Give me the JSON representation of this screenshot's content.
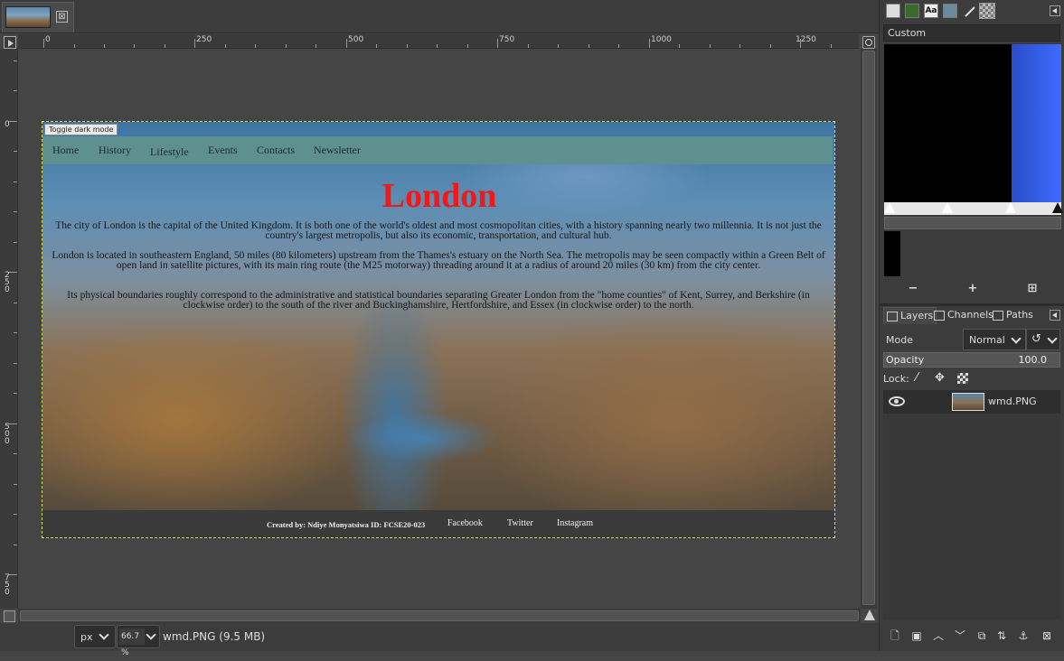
{
  "image_tab": {
    "close_glyph": "⊠"
  },
  "ruler": {
    "h_labels": [
      "0",
      "250",
      "500",
      "750",
      "1000",
      "1250"
    ],
    "v_labels": [
      "0",
      "250",
      "500",
      "750"
    ]
  },
  "webpage": {
    "dark_mode_button": "Toggle dark mode",
    "nav": [
      "Home",
      "History",
      "Lifestyle",
      "Events",
      "Contacts",
      "Newsletter"
    ],
    "title": "London",
    "paragraphs": [
      "The city of London is the capital of the United Kingdom. It is both one of the world's oldest and most cosmopolitan cities, with a history spanning nearly two millennia. It is not just the country's largest metropolis, but also its economic, transportation, and cultural hub.",
      "London is located in southeastern England, 50 miles (80 kilometers) upstream from the Thames's estuary on the North Sea. The metropolis may be seen compactly within a Green Belt of open land in satellite pictures, with its main ring route (the M25 motorway) threading around it at a radius of around 20 miles (30 km) from the city center.",
      "Its physical boundaries roughly correspond to the administrative and statistical boundaries separating Greater London from the \"home counties\" of Kent, Surrey, and Berkshire (in clockwise order) to the south of the river and Buckinghamshire, Hertfordshire, and Essex (in clockwise order) to the north."
    ],
    "footer": {
      "credit": "Created by: Ndiye Monyatsiwa ID: FCSE20-023",
      "links": [
        "Facebook",
        "Twitter",
        "Instagram"
      ]
    },
    "colors": {
      "title": "#ee1a1a",
      "nav_bg": "#5f9090",
      "footer_bg": "#3a3a3a"
    }
  },
  "statusbar": {
    "unit": "px",
    "zoom": "66.7 %",
    "file_info": "wmd.PNG (9.5 MB)"
  },
  "dock": {
    "tab_icons": [
      "brush-icon",
      "pattern-icon",
      "font-icon",
      "document-icon",
      "paintbrush-icon",
      "gradient-icon"
    ],
    "gradient_name": "Custom",
    "gradient_buttons": [
      "−",
      "+",
      "⊞"
    ],
    "layer_tabs": [
      "Layers",
      "Channels",
      "Paths"
    ],
    "mode_label": "Mode",
    "mode_value": "Normal",
    "opacity_label": "Opacity",
    "opacity_value": "100.0",
    "lock_label": "Lock:",
    "layer_name": "wmd.PNG",
    "bottom_icons": [
      "new-layer-icon",
      "new-group-icon",
      "raise-layer-icon",
      "lower-layer-icon",
      "duplicate-layer-icon",
      "merge-down-icon",
      "anchor-icon",
      "delete-layer-icon"
    ]
  }
}
